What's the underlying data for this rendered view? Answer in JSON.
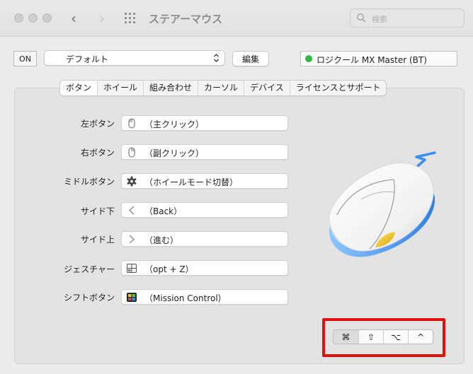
{
  "window": {
    "title": "ステアーマウス"
  },
  "search": {
    "placeholder": "検索"
  },
  "toolbar": {
    "on_label": "ON",
    "profile_value": "デフォルト",
    "edit_label": "編集",
    "device_name": "ロジクール MX Master (BT)",
    "device_status_color": "#2fb744"
  },
  "tabs": [
    {
      "label": "ボタン",
      "active": true
    },
    {
      "label": "ホイール"
    },
    {
      "label": "組み合わせ"
    },
    {
      "label": "カーソル"
    },
    {
      "label": "デバイス"
    },
    {
      "label": "ライセンスとサポート"
    }
  ],
  "buttons": [
    {
      "label": "左ボタン",
      "icon": "mouse-icon",
      "value": "（主クリック）"
    },
    {
      "label": "右ボタン",
      "icon": "mouse-icon",
      "value": "（副クリック）"
    },
    {
      "label": "ミドルボタン",
      "icon": "gear-icon",
      "value": "（ホイールモード切替）"
    },
    {
      "label": "サイド下",
      "icon": "chevron-left-icon",
      "value": "（Back）"
    },
    {
      "label": "サイド上",
      "icon": "chevron-right-icon",
      "value": "（進む）"
    },
    {
      "label": "ジェスチャー",
      "icon": "gesture-grid-icon",
      "value": "（opt + Z）"
    },
    {
      "label": "シフトボタン",
      "icon": "mission-control-icon",
      "value": "（Mission Control）"
    }
  ],
  "modifiers": [
    "⌘",
    "⇧",
    "⌥",
    "^"
  ],
  "highlight_color": "#e0120f"
}
